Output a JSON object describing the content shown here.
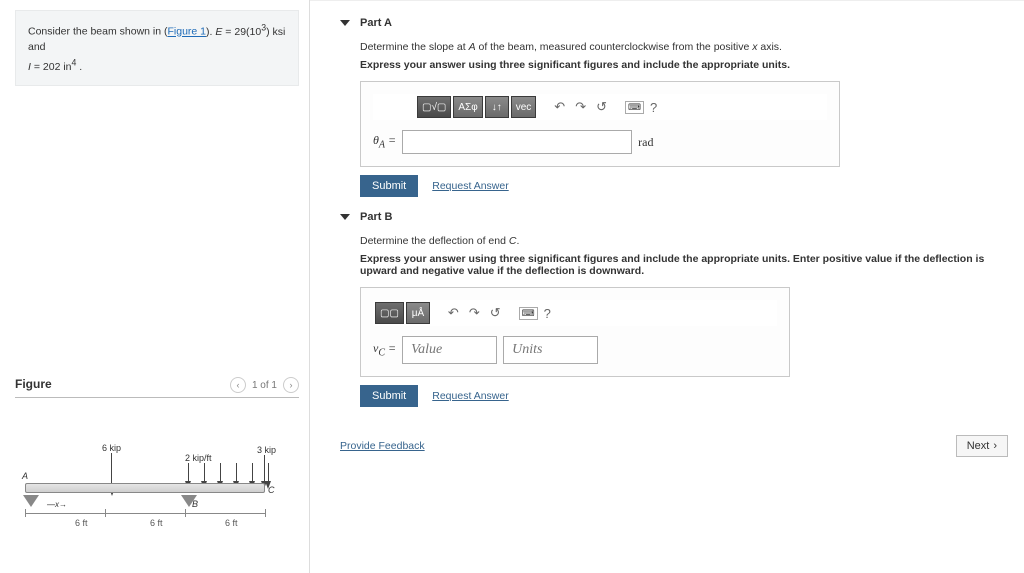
{
  "problem": {
    "prefix": "Consider the beam shown in (",
    "figure_link": "Figure 1",
    "suffix_html": "). E = 29(10³) ksi and I = 202 in⁴ ."
  },
  "figure": {
    "title": "Figure",
    "counter": "1 of 1",
    "labels": {
      "load_6kip": "6 kip",
      "load_2kipft": "2 kip/ft",
      "load_3kip": "3 kip",
      "A": "A",
      "B": "B",
      "C": "C",
      "x": "x",
      "dim": "6 ft"
    }
  },
  "partA": {
    "title": "Part A",
    "prompt": "Determine the slope at A of the beam, measured counterclockwise from the positive x axis.",
    "instructions": "Express your answer using three significant figures and include the appropriate units.",
    "variable": "θ",
    "subscript": "A",
    "equals": " = ",
    "unit": "rad",
    "submit": "Submit",
    "request": "Request Answer",
    "toolbar": {
      "greek": "ΑΣφ",
      "sub": "↓↑",
      "vec": "vec",
      "undo": "↶",
      "redo": "↷",
      "reset": "↺",
      "kbd": "⌨",
      "help": "?"
    }
  },
  "partB": {
    "title": "Part B",
    "prompt": "Determine the deflection of end C.",
    "instructions": "Express your answer using three significant figures and include the appropriate units. Enter positive value if the deflection is upward and negative value if the deflection is downward.",
    "variable": "v",
    "subscript": "C",
    "equals": " = ",
    "value_placeholder": "Value",
    "units_placeholder": "Units",
    "submit": "Submit",
    "request": "Request Answer",
    "toolbar": {
      "units": "μÅ",
      "undo": "↶",
      "redo": "↷",
      "reset": "↺",
      "kbd": "⌨",
      "help": "?"
    }
  },
  "footer": {
    "feedback": "Provide Feedback",
    "next": "Next"
  }
}
